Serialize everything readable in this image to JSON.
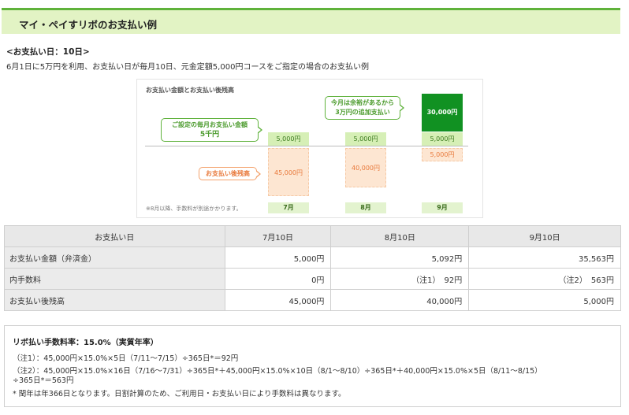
{
  "header": {
    "title": "マイ・ペイすリボのお支払い例"
  },
  "subtitle": "<お支払い日：10日>",
  "intro": "6月1日に5万円を利用、お支払い日が毎月10日、元金定額5,000円コースをご指定の場合のお支払い例",
  "figure": {
    "title": "お支払い金額とお支払い後残高",
    "bubble_monthly": [
      "ご設定の毎月お支払い金額",
      "5千円"
    ],
    "bubble_balance": "お支払い後残高",
    "bubble_extra": [
      "今月は余裕があるから",
      "3万円の追加支払い"
    ],
    "note": "※8月以降、手数料が別途かかります。",
    "columns": [
      {
        "month": "7月",
        "payment": "5,000円",
        "balance": "45,000円"
      },
      {
        "month": "8月",
        "payment": "5,000円",
        "balance": "40,000円"
      },
      {
        "month": "9月",
        "extra": "30,000円",
        "payment": "5,000円",
        "balance": "5,000円"
      }
    ]
  },
  "table": {
    "headers": [
      "お支払い日",
      "7月10日",
      "8月10日",
      "9月10日"
    ],
    "rows": [
      {
        "label": "お支払い金額（弁済金）",
        "cells": [
          "5,000円",
          "5,092円",
          "35,563円"
        ]
      },
      {
        "label": "内手数料",
        "cells": [
          "0円",
          "（注1）　92円",
          "（注2）　563円"
        ]
      },
      {
        "label": "お支払い後残高",
        "cells": [
          "45,000円",
          "40,000円",
          "5,000円"
        ]
      }
    ]
  },
  "notes": {
    "title": "リボ払い手数料率：15.0%（実質年率）",
    "lines": [
      "（注1）：45,000円×15.0%×5日（7/11〜7/15）÷365日*＝92円",
      "（注2）：45,000円×15.0%×16日（7/16〜7/31）÷365日*＋45,000円×15.0%×10日（8/1〜8/10）÷365日*＋40,000円×15.0%×5日（8/11〜8/15）",
      "÷365日*＝563円",
      "* 閏年は年366日となります。日割計算のため、ご利用日・お支払い日により手数料は異なります。"
    ]
  },
  "colors": {
    "accent_green": "#5fb23b",
    "header_bg": "#e2f3c4",
    "balance_orange": "#e8783a"
  }
}
